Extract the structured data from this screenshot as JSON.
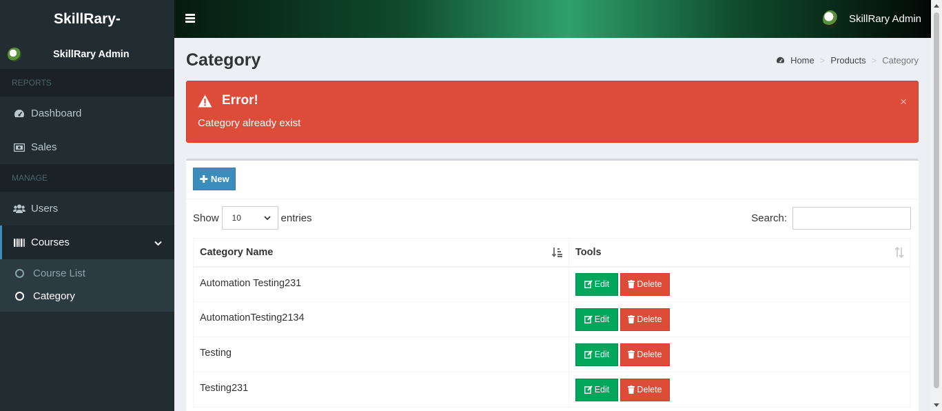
{
  "sidebar": {
    "logo": "SkillRary-",
    "user_name": "SkillRary Admin",
    "headers": {
      "reports": "REPORTS",
      "manage": "MANAGE"
    },
    "items": {
      "dashboard": "Dashboard",
      "sales": "Sales",
      "users": "Users",
      "courses": "Courses"
    },
    "submenu": {
      "course_list": "Course List",
      "category": "Category"
    }
  },
  "topbar": {
    "user_name": "SkillRary Admin"
  },
  "page": {
    "title": "Category",
    "breadcrumb": {
      "home": "Home",
      "products": "Products",
      "current": "Category"
    }
  },
  "alert": {
    "title": "Error!",
    "message": "Category already exist",
    "close": "×"
  },
  "toolbar": {
    "new_label": "New"
  },
  "table_controls": {
    "show_label": "Show",
    "entries_value": "10",
    "entries_label": "entries",
    "search_label": "Search:",
    "search_value": ""
  },
  "table": {
    "headers": {
      "name": "Category Name",
      "tools": "Tools"
    },
    "rows": [
      {
        "name": "Automation Testing231"
      },
      {
        "name": "AutomationTesting2134"
      },
      {
        "name": "Testing"
      },
      {
        "name": "Testing231"
      }
    ],
    "edit_label": "Edit",
    "delete_label": "Delete"
  },
  "colors": {
    "sidebar_bg": "#222d32",
    "primary": "#3c8dbc",
    "danger": "#dd4b39",
    "success": "#00a65a",
    "content_bg": "#ecf0f5"
  }
}
